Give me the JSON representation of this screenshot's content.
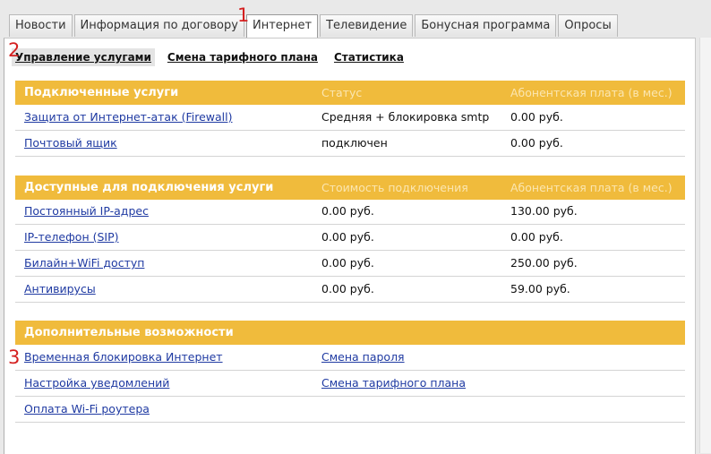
{
  "tabs": [
    "Новости",
    "Информация по договору",
    "Интернет",
    "Телевидение",
    "Бонусная программа",
    "Опросы"
  ],
  "markers": [
    "1",
    "2",
    "3"
  ],
  "subnav": [
    "Управление услугами",
    "Смена тарифного плана",
    "Статистика"
  ],
  "connected": {
    "title": "Подключенные услуги",
    "col_status": "Статус",
    "col_fee": "Абонентская плата (в мес.)",
    "rows": [
      {
        "name": "Защита от Интернет-атак (Firewall)",
        "status": "Средняя + блокировка smtp",
        "fee": "0.00 руб."
      },
      {
        "name": "Почтовый ящик",
        "status": "подключен",
        "fee": "0.00 руб."
      }
    ]
  },
  "available": {
    "title": "Доступные для подключения услуги",
    "col_cost": "Стоимость подключения",
    "col_fee": "Абонентская плата (в мес.)",
    "rows": [
      {
        "name": "Постоянный IP-адрес",
        "cost": "0.00 руб.",
        "fee": "130.00 руб."
      },
      {
        "name": "IP-телефон (SIP)",
        "cost": "0.00 руб.",
        "fee": "0.00 руб."
      },
      {
        "name": "Билайн+WiFi доступ",
        "cost": "0.00 руб.",
        "fee": "250.00 руб."
      },
      {
        "name": "Антивирусы",
        "cost": "0.00 руб.",
        "fee": "59.00 руб."
      }
    ]
  },
  "extra": {
    "title": "Дополнительные возможности",
    "rows": [
      {
        "left": "Временная блокировка Интернет",
        "right": "Смена пароля"
      },
      {
        "left": "Настройка уведомлений",
        "right": "Смена тарифного плана"
      },
      {
        "left": "Оплата Wi-Fi роутера",
        "right": ""
      }
    ]
  },
  "colors": {
    "accent": "#f0bb3c",
    "link": "#1f3aa2",
    "marker": "#d42020"
  }
}
